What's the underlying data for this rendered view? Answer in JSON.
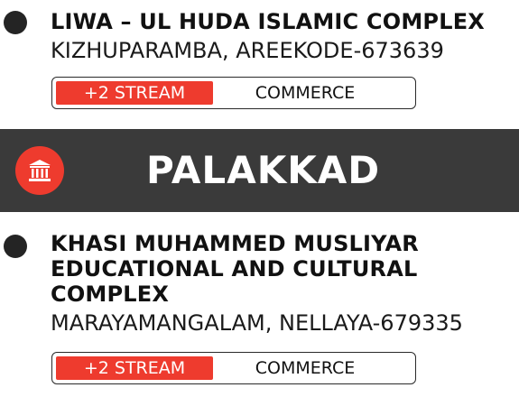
{
  "entries_top": [
    {
      "name_lines": [
        "LIWA – UL HUDA ISLAMIC COMPLEX"
      ],
      "address": "KIZHUPARAMBA, AREEKODE-673639",
      "stream": "+2 STREAM",
      "course": "COMMERCE"
    }
  ],
  "district": {
    "icon": "institution-icon",
    "title": "PALAKKAD"
  },
  "entries_bottom": [
    {
      "name_lines": [
        "KHASI MUHAMMED MUSLIYAR",
        "EDUCATIONAL AND CULTURAL",
        "COMPLEX"
      ],
      "address": "MARAYAMANGALAM, NELLAYA-679335",
      "stream": "+2 STREAM",
      "course": "COMMERCE"
    }
  ],
  "colors": {
    "accent": "#ee3b2e",
    "band": "#3a3a3a",
    "bullet": "#242424"
  }
}
